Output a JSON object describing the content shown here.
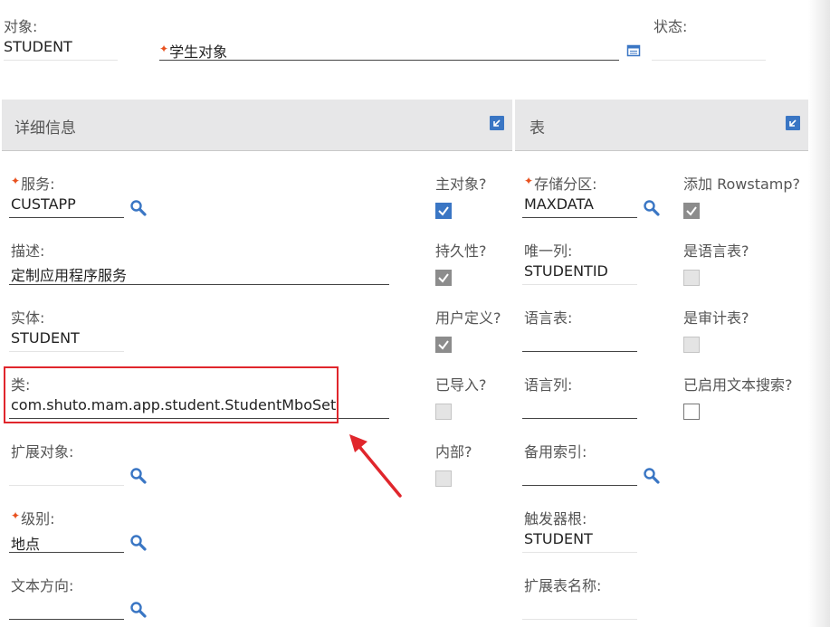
{
  "header": {
    "object_label": "对象:",
    "object_value": "STUDENT",
    "description_value": "学生对象",
    "status_label": "状态:",
    "status_value": ""
  },
  "sections": {
    "details_title": "详细信息",
    "table_title": "表"
  },
  "details": {
    "service_label": "服务:",
    "service_value": "CUSTAPP",
    "description_label": "描述:",
    "description_value": "定制应用程序服务",
    "entity_label": "实体:",
    "entity_value": "STUDENT",
    "class_label": "类:",
    "class_value": "com.shuto.mam.app.student.StudentMboSet",
    "ext_object_label": "扩展对象:",
    "ext_object_value": "",
    "level_label": "级别:",
    "level_value": "地点",
    "text_direction_label": "文本方向:",
    "text_direction_value": ""
  },
  "flags": {
    "main_object_label": "主对象?",
    "main_object_checked": true,
    "persistent_label": "持久性?",
    "persistent_checked": true,
    "user_defined_label": "用户定义?",
    "user_defined_checked": true,
    "imported_label": "已导入?",
    "imported_checked": false,
    "internal_label": "内部?",
    "internal_checked": false
  },
  "table": {
    "storage_label": "存储分区:",
    "storage_value": "MAXDATA",
    "unique_col_label": "唯一列:",
    "unique_col_value": "STUDENTID",
    "lang_table_label": "语言表:",
    "lang_table_value": "",
    "lang_col_label": "语言列:",
    "lang_col_value": "",
    "alt_index_label": "备用索引:",
    "alt_index_value": "",
    "trigger_root_label": "触发器根:",
    "trigger_root_value": "STUDENT",
    "ext_table_label": "扩展表名称:",
    "ext_table_value": ""
  },
  "table_flags": {
    "add_rowstamp_label": "添加 Rowstamp?",
    "add_rowstamp_checked": true,
    "is_lang_table_label": "是语言表?",
    "is_lang_table_checked": false,
    "is_audit_label": "是审计表?",
    "is_audit_checked": false,
    "text_search_label": "已启用文本搜索?",
    "text_search_checked": false
  },
  "colors": {
    "accent": "#3a76c4",
    "required_star": "#e8511f",
    "highlight": "#e0262c",
    "section_bg": "#e7e7e8"
  },
  "icons": {
    "lookup": "magnifier-icon",
    "long_description": "detail-window-icon",
    "collapse": "collapse-arrow-icon",
    "annotation_arrow": "red-arrow-icon"
  }
}
